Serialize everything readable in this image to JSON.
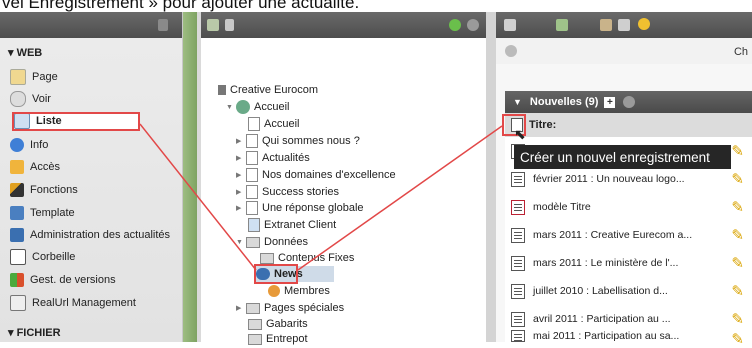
{
  "caption": "vel Enregistrement » pour ajouter une actualité.",
  "module_menu": {
    "section_web": "▾ WEB",
    "items": [
      {
        "label": "Page",
        "icon": "page-edit-icon"
      },
      {
        "label": "Voir",
        "icon": "eye-icon"
      },
      {
        "label": "Liste",
        "icon": "list-icon"
      },
      {
        "label": "Info",
        "icon": "info-icon"
      },
      {
        "label": "Accès",
        "icon": "lock-icon"
      },
      {
        "label": "Fonctions",
        "icon": "wand-icon"
      },
      {
        "label": "Template",
        "icon": "template-icon"
      },
      {
        "label": "Administration des actualités",
        "icon": "news-admin-icon"
      },
      {
        "label": "Corbeille",
        "icon": "trash-icon"
      },
      {
        "label": "Gest. de versions",
        "icon": "versions-icon"
      },
      {
        "label": "RealUrl Management",
        "icon": "url-icon"
      }
    ],
    "section_fichier": "▾ FICHIER"
  },
  "tree": {
    "root": "Creative Eurocom",
    "nodes": [
      "Accueil",
      "Accueil",
      "Qui sommes nous ?",
      "Actualités",
      "Nos domaines d'excellence",
      "Success stories",
      "Une réponse globale",
      "Extranet Client",
      "Données",
      "Contenus Fixes",
      "News",
      "Membres",
      "Pages spéciales",
      "Gabarits",
      "Entrepot"
    ]
  },
  "right_panel": {
    "ch": "Ch",
    "list_header": "Nouvelles (9)",
    "col_title": "Titre:",
    "tooltip": "Créer un nouvel enregistrement",
    "records": [
      "février 2011 : Un nouveau logo...",
      "modèle Titre",
      "mars 2011 : Creative Eurecom a...",
      "mars 2011 : Le ministère de l'...",
      "juillet 2010 : Labellisation d...",
      "avril 2011 : Participation au ...",
      "mai 2011 : Participation au sa..."
    ]
  },
  "colors": {
    "accent_red": "#e24848",
    "header_dark": "#555555",
    "green_bar": "#8cb070"
  }
}
